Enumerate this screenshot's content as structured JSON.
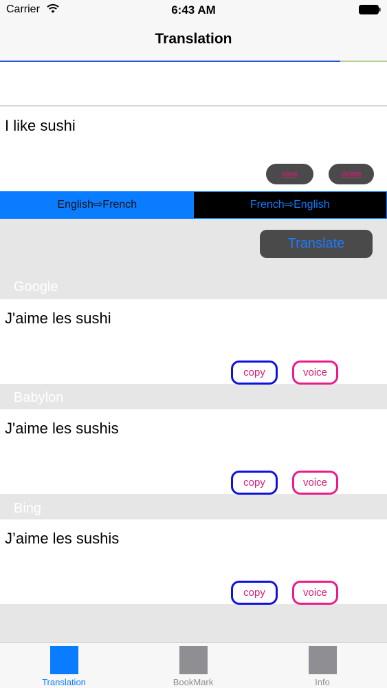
{
  "status_bar": {
    "carrier": "Carrier",
    "time": "6:43 AM"
  },
  "nav": {
    "title": "Translation",
    "progress": 0.88
  },
  "input": {
    "text": "I like sushi",
    "save_label": "save",
    "delete_label": "delete"
  },
  "direction": {
    "options": [
      "English⇨French",
      "French⇨English"
    ],
    "selected": "English⇨French"
  },
  "translate_button": "Translate",
  "results": [
    {
      "source": "Google",
      "text": "J'aime les sushi",
      "copy_label": "copy",
      "voice_label": "voice"
    },
    {
      "source": "Babylon",
      "text": "J'aime les sushis",
      "copy_label": "copy",
      "voice_label": "voice"
    },
    {
      "source": "Bing",
      "text": "J’aime les sushis",
      "copy_label": "copy",
      "voice_label": "voice"
    }
  ],
  "tabs": [
    {
      "label": "Translation",
      "icon": "square-icon",
      "active": true
    },
    {
      "label": "BookMark",
      "icon": "square-icon",
      "active": false
    },
    {
      "label": "Info",
      "icon": "square-icon",
      "active": false
    }
  ],
  "colors": {
    "accent": "#0a7cff",
    "pink": "#d81b76",
    "copy_border": "#1010e0",
    "voice_border": "#ec1b8a",
    "inactive_tab": "#8e8e93"
  }
}
